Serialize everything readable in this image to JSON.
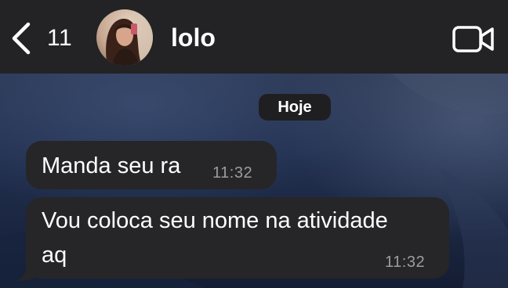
{
  "header": {
    "back_count": "11",
    "contact_name": "lolo",
    "back_icon": "chevron-left-icon",
    "video_icon": "video-camera-icon",
    "avatar_description": "contact-avatar"
  },
  "chat": {
    "date_label": "Hoje",
    "messages": [
      {
        "text": "Manda seu ra",
        "time": "11:32",
        "direction": "incoming"
      },
      {
        "text": "Vou coloca seu nome na atividade\naq",
        "time": "11:32",
        "direction": "incoming"
      }
    ]
  },
  "colors": {
    "header_bg": "#232325",
    "bubble_bg": "#262628",
    "text": "#ffffff",
    "time_text": "#9c9ca2",
    "chat_bg_top": "#2b3754",
    "chat_bg_bottom": "#141d33"
  }
}
